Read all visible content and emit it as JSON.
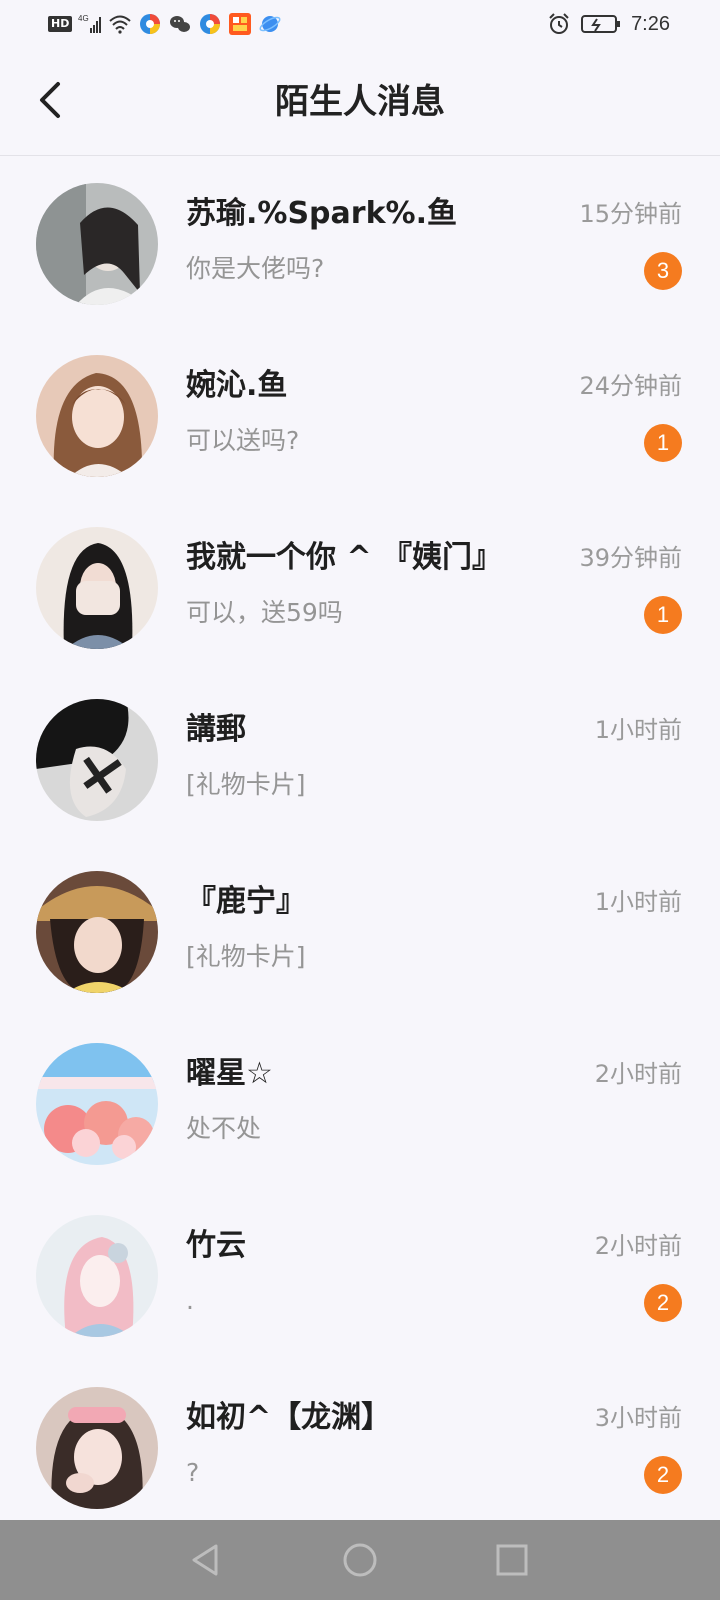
{
  "status_bar": {
    "hd_label": "HD",
    "network": "4G",
    "time": "7:26"
  },
  "header": {
    "title": "陌生人消息"
  },
  "messages": [
    {
      "name": "苏瑜.%Spark%.鱼",
      "time": "15分钟前",
      "preview": "你是大佬吗?",
      "unread": "3"
    },
    {
      "name": "婉沁.鱼",
      "time": "24分钟前",
      "preview": "可以送吗?",
      "unread": "1"
    },
    {
      "name": "我就一个你 ^ 『姨门』",
      "time": "39分钟前",
      "preview": "可以，送59吗",
      "unread": "1"
    },
    {
      "name": "講郵",
      "time": "1小时前",
      "preview": "[礼物卡片]",
      "unread": ""
    },
    {
      "name": "『鹿宁』",
      "time": "1小时前",
      "preview": "[礼物卡片]",
      "unread": ""
    },
    {
      "name": "曜星☆",
      "time": "2小时前",
      "preview": "处不处",
      "unread": ""
    },
    {
      "name": "竹云",
      "time": "2小时前",
      "preview": ".",
      "unread": "2"
    },
    {
      "name": "如初^【龙渊】",
      "time": "3小时前",
      "preview": "?",
      "unread": "2"
    }
  ],
  "colors": {
    "background": "#f7f6fb",
    "badge": "#f57b1f",
    "nav_bar": "#8f8f8f"
  }
}
